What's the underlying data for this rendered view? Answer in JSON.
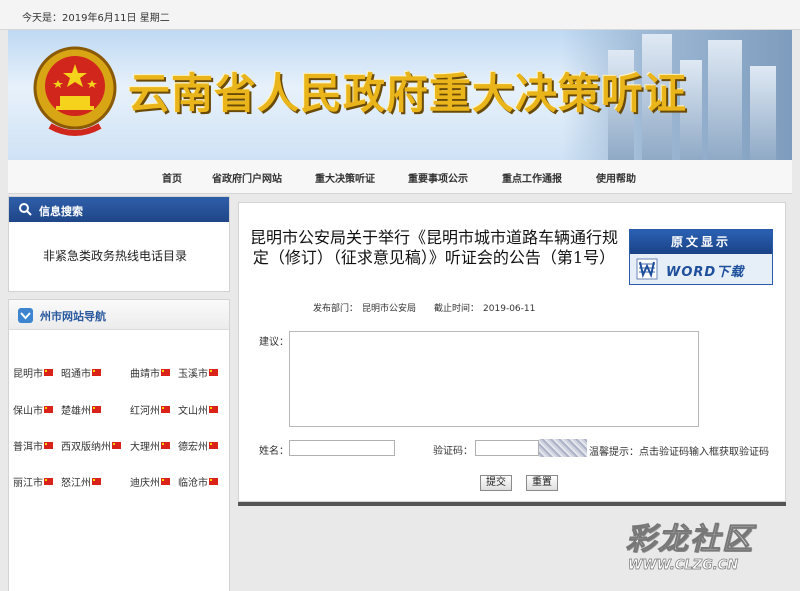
{
  "date_bar": {
    "text": "今天是：2019年6月11日 星期二"
  },
  "banner": {
    "title": "云南省人民政府重大决策听证"
  },
  "nav": {
    "items": [
      "首页",
      "省政府门户网站",
      "重大决策听证",
      "重要事项公示",
      "重点工作通报",
      "使用帮助"
    ]
  },
  "sidebar": {
    "search_title": "信息搜索",
    "hotline": "非紧急类政务热线电话目录",
    "cities_title": "州市网站导航",
    "cities": [
      "昆明市",
      "昭通市",
      "曲靖市",
      "玉溪市",
      "保山市",
      "楚雄州",
      "红河州",
      "文山州",
      "普洱市",
      "西双版纳州",
      "大理州",
      "德宏州",
      "丽江市",
      "怒江州",
      "迪庆州",
      "临沧市"
    ]
  },
  "article": {
    "title": "昆明市公安局关于举行《昆明市城市道路车辆通行规定（修订）（征求意见稿）》听证会的公告（第1号）",
    "dept_label": "发布部门：",
    "dept": "昆明市公安局",
    "deadline_label": "截止时间：",
    "deadline": "2019-06-11"
  },
  "original": {
    "header": "原文显示",
    "download": "WORD下载"
  },
  "form": {
    "suggestion_label": "建议：",
    "name_label": "姓名：",
    "captcha_label": "验证码：",
    "hint": "温馨提示：点击验证码输入框获取验证码",
    "submit": "提交",
    "reset": "重置"
  },
  "watermark": {
    "main": "彩龙社区",
    "url": "WWW.CLZG.CN"
  },
  "colors": {
    "accent": "#1f4688",
    "title_gold": "#e9b51a"
  }
}
